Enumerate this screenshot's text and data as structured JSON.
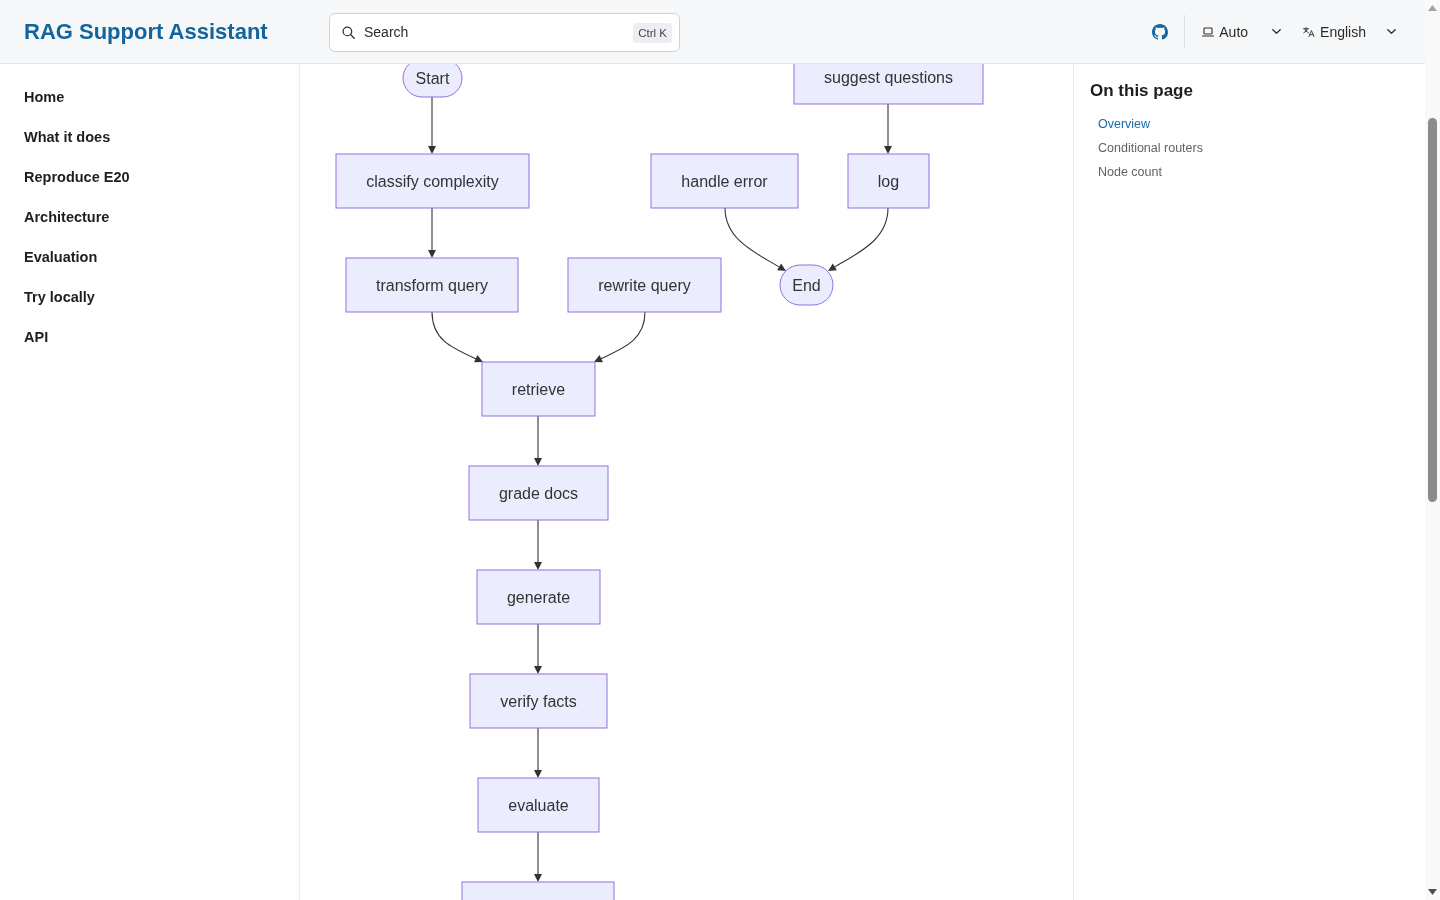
{
  "header": {
    "title": "RAG Support Assistant",
    "search": {
      "placeholder": "Search",
      "shortcut": "Ctrl K"
    },
    "theme_select": {
      "value": "Auto"
    },
    "language_select": {
      "value": "English"
    }
  },
  "sidebar": {
    "items": [
      {
        "label": "Home"
      },
      {
        "label": "What it does"
      },
      {
        "label": "Reproduce E20"
      },
      {
        "label": "Architecture"
      },
      {
        "label": "Evaluation"
      },
      {
        "label": "Try locally"
      },
      {
        "label": "API"
      }
    ]
  },
  "diagram": {
    "nodes": [
      {
        "kind": "stadium",
        "label": "Start"
      },
      {
        "kind": "rect",
        "label": "suggest questions"
      },
      {
        "kind": "rect",
        "label": "classify complexity"
      },
      {
        "kind": "rect",
        "label": "handle error"
      },
      {
        "kind": "rect",
        "label": "log"
      },
      {
        "kind": "rect",
        "label": "transform query"
      },
      {
        "kind": "rect",
        "label": "rewrite query"
      },
      {
        "kind": "stadium",
        "label": "End"
      },
      {
        "kind": "rect",
        "label": "retrieve"
      },
      {
        "kind": "rect",
        "label": "grade docs"
      },
      {
        "kind": "rect",
        "label": "generate"
      },
      {
        "kind": "rect",
        "label": "verify facts"
      },
      {
        "kind": "rect",
        "label": "evaluate"
      },
      {
        "kind": "rect"
      }
    ]
  },
  "toc": {
    "title": "On this page",
    "items": [
      {
        "label": "Overview",
        "selected": true
      },
      {
        "label": "Conditional routers",
        "selected": false
      },
      {
        "label": "Node count",
        "selected": false
      }
    ]
  }
}
